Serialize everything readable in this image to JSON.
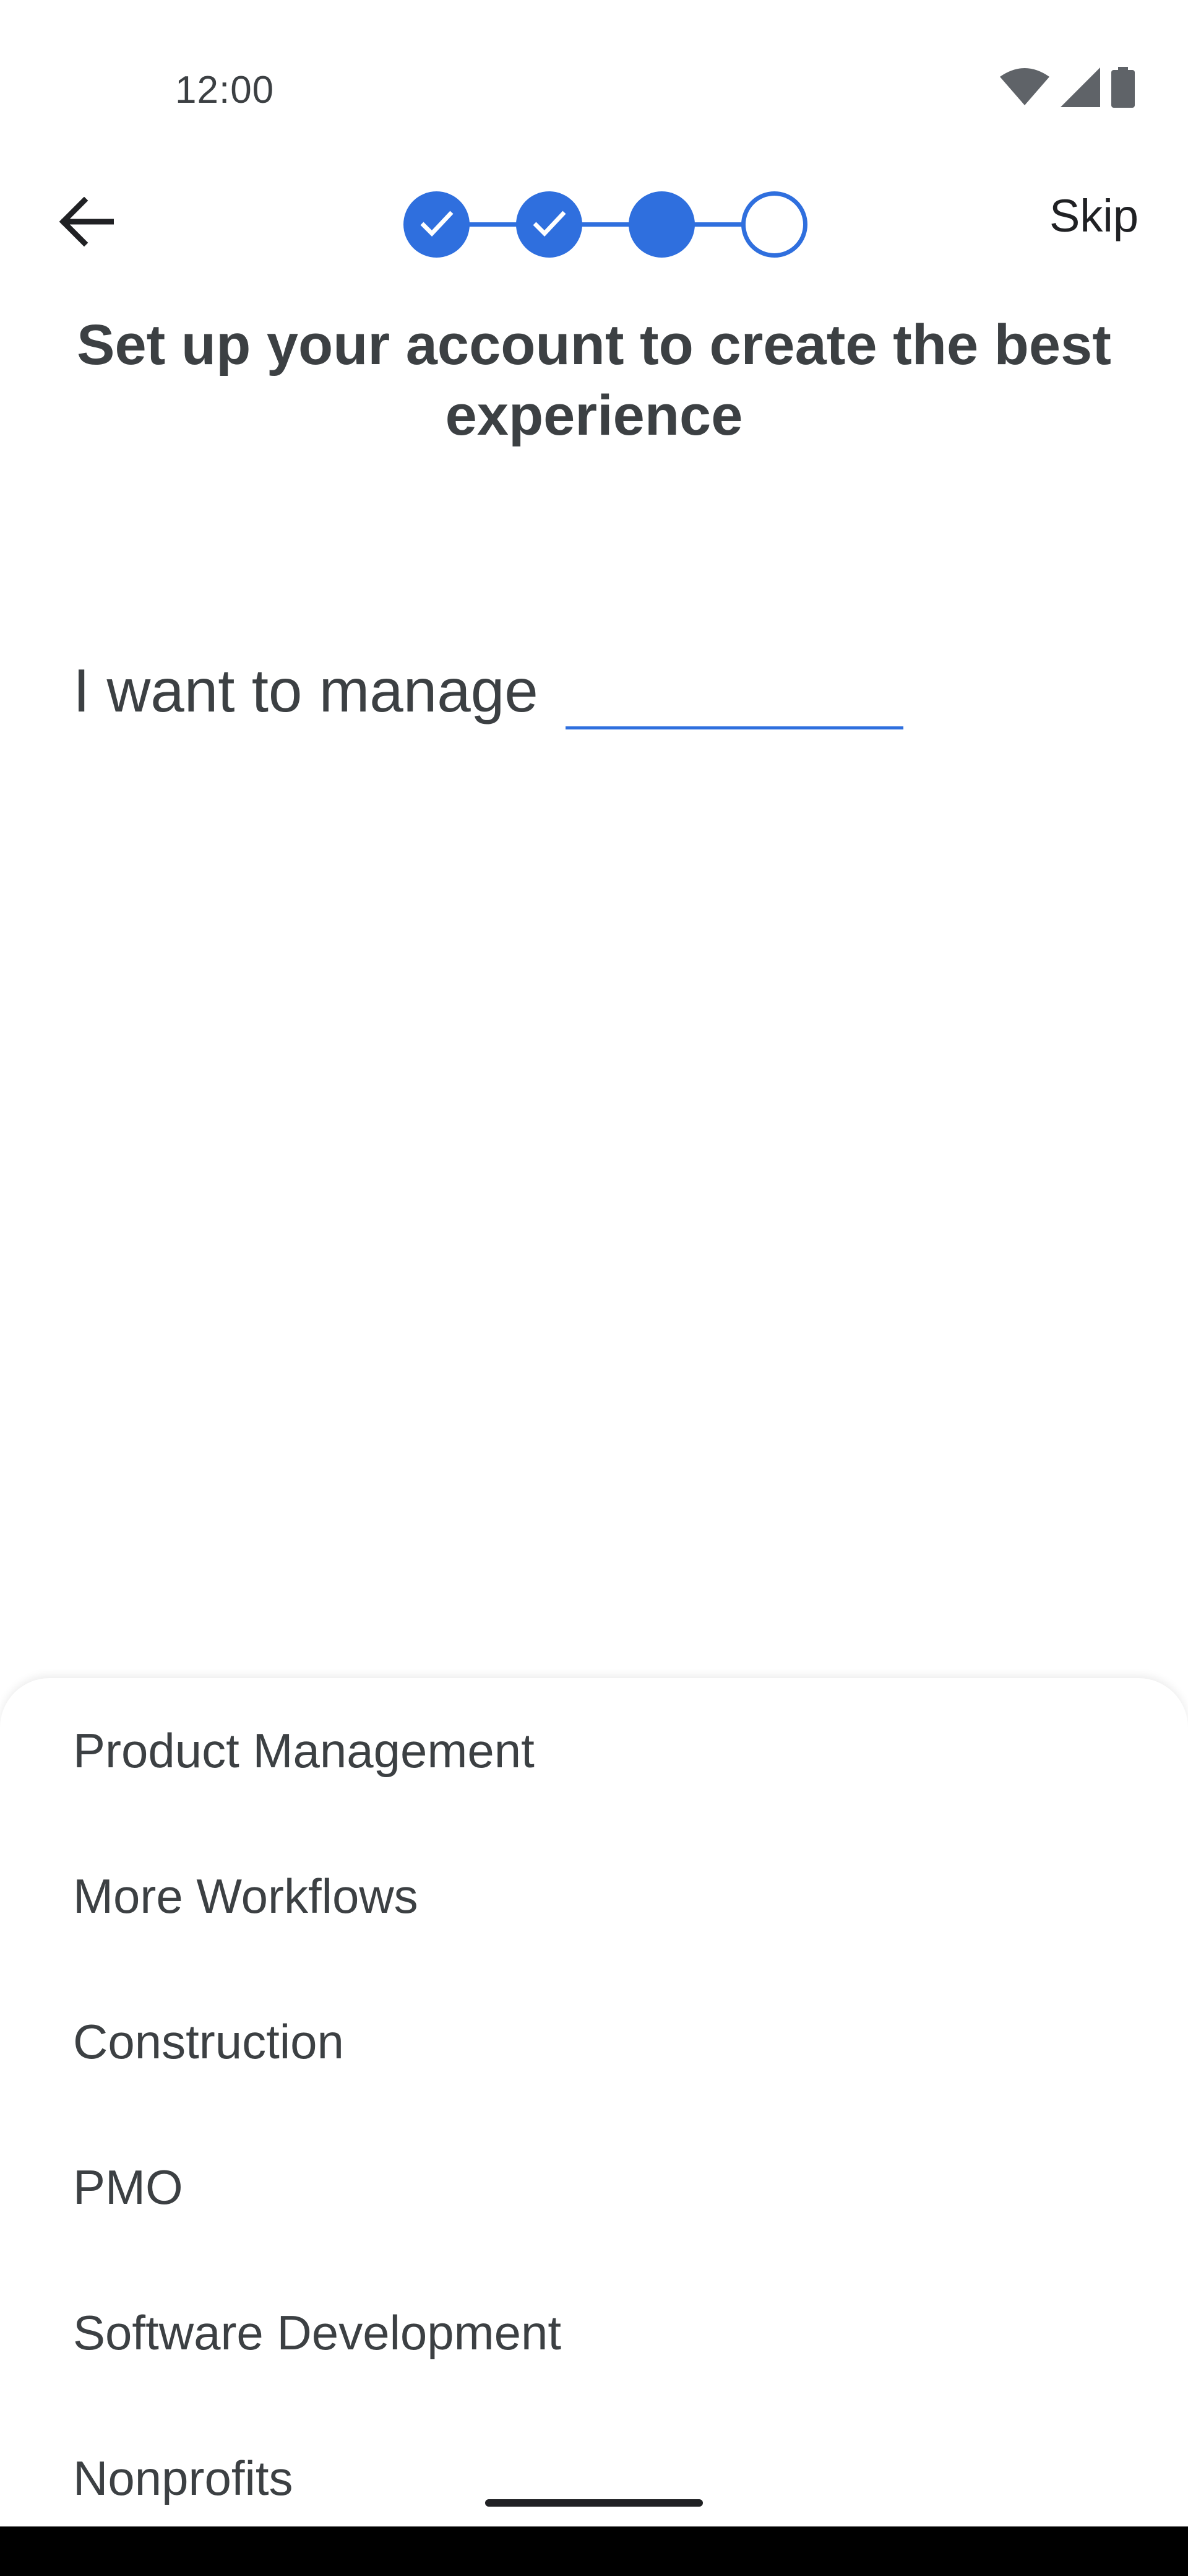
{
  "status_bar": {
    "time": "12:00",
    "icons": [
      "wifi-icon",
      "cellular-signal-icon",
      "battery-icon"
    ]
  },
  "header": {
    "back_icon": "arrow-back-icon",
    "skip_label": "Skip",
    "stepper": {
      "total_steps": 4,
      "completed_steps": 2,
      "current_step": 3
    }
  },
  "main": {
    "title": "Set up your account to create the best experience",
    "manage_label": "I want to manage",
    "manage_value": ""
  },
  "options_sheet": {
    "items": [
      "Product Management",
      "More Workflows",
      "Construction",
      "PMO",
      "Software Development",
      "Nonprofits"
    ]
  },
  "colors": {
    "accent": "#2f6fde",
    "text": "#3c4043",
    "nav_bar": "#000000"
  }
}
